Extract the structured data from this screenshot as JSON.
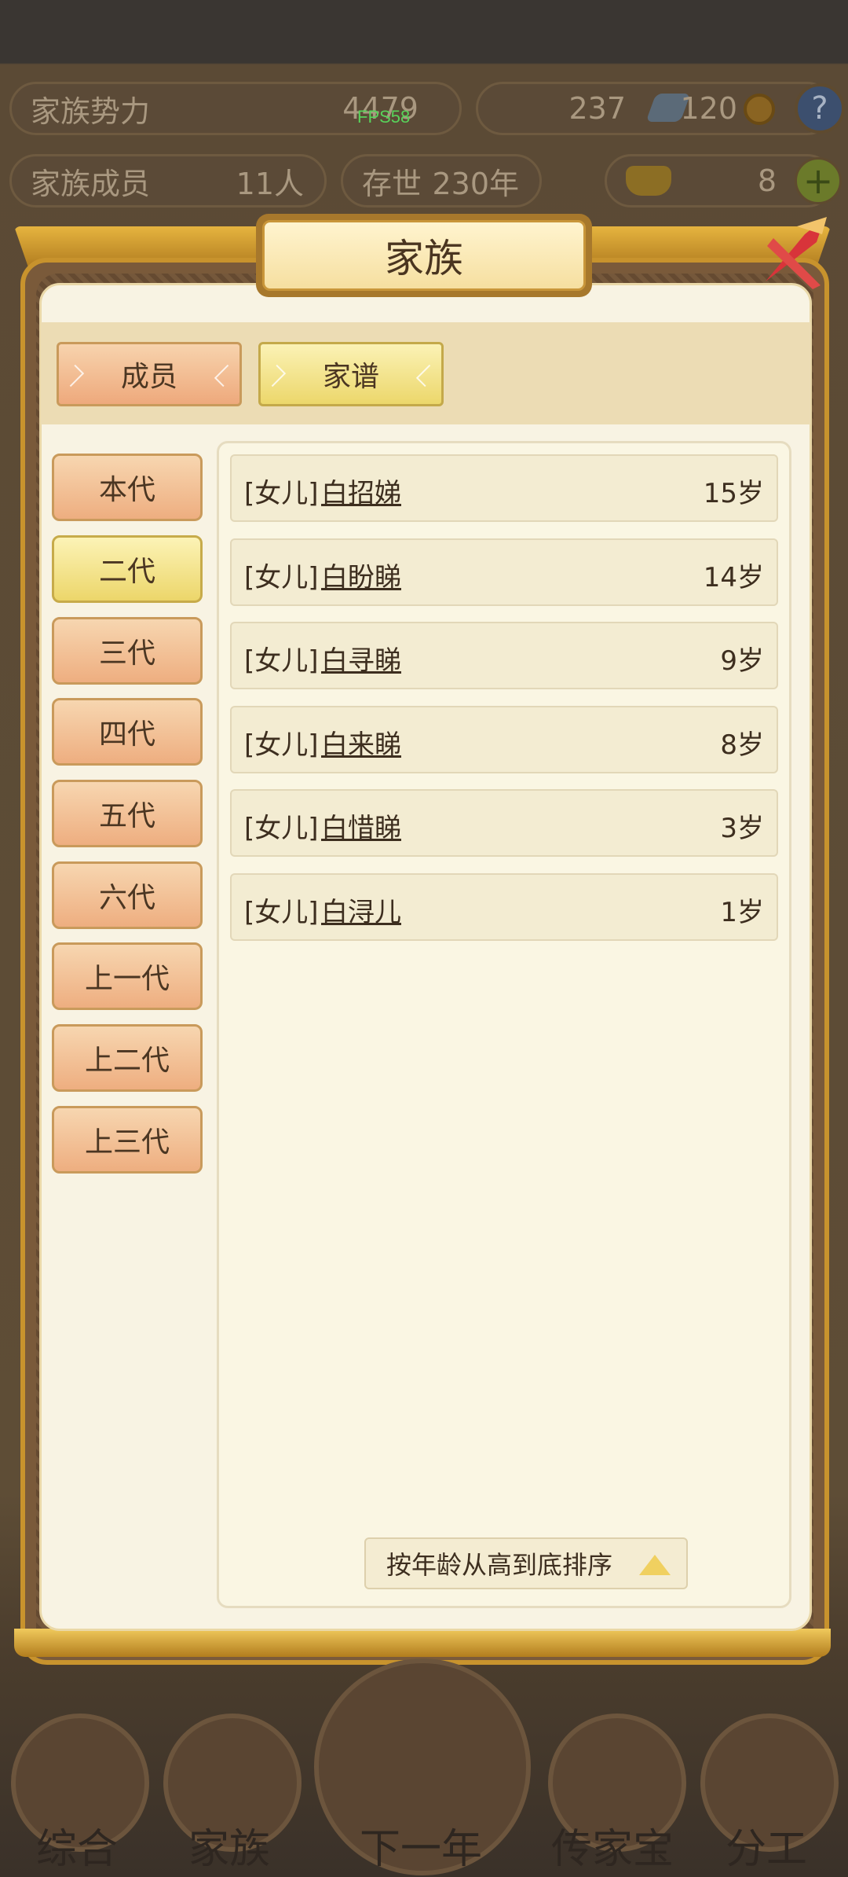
{
  "hud": {
    "family_power_label": "家族势力",
    "family_power_value": "4479",
    "fps": "FPS58",
    "silver": "237",
    "coins": "120",
    "help": "?",
    "members_label": "家族成员",
    "members_value": "11人",
    "alive_label": "存世",
    "alive_value": "230年",
    "gold": "8",
    "plus": "+"
  },
  "modal": {
    "title": "家族",
    "tabs": [
      {
        "label": "成员",
        "active": false
      },
      {
        "label": "家谱",
        "active": true
      }
    ],
    "generations": [
      {
        "label": "本代",
        "active": false
      },
      {
        "label": "二代",
        "active": true
      },
      {
        "label": "三代",
        "active": false
      },
      {
        "label": "四代",
        "active": false
      },
      {
        "label": "五代",
        "active": false
      },
      {
        "label": "六代",
        "active": false
      },
      {
        "label": "上一代",
        "active": false
      },
      {
        "label": "上二代",
        "active": false
      },
      {
        "label": "上三代",
        "active": false
      }
    ],
    "members": [
      {
        "relation": "[女儿]",
        "name": "白招娣",
        "age": "15岁"
      },
      {
        "relation": "[女儿]",
        "name": "白盼睇",
        "age": "14岁"
      },
      {
        "relation": "[女儿]",
        "name": "白寻睇",
        "age": "9岁"
      },
      {
        "relation": "[女儿]",
        "name": "白来睇",
        "age": "8岁"
      },
      {
        "relation": "[女儿]",
        "name": "白惜睇",
        "age": "3岁"
      },
      {
        "relation": "[女儿]",
        "name": "白浔儿",
        "age": "1岁"
      }
    ],
    "sort_label": "按年龄从高到底排序"
  },
  "bottom_nav": [
    {
      "label": "综合",
      "icon": "scroll-icon"
    },
    {
      "label": "家族",
      "icon": "house-icon"
    },
    {
      "label": "下一年",
      "icon": "mountain-icon"
    },
    {
      "label": "传家宝",
      "icon": "jade-icon"
    },
    {
      "label": "分工",
      "icon": "people-icon"
    }
  ],
  "colors": {
    "tab_active": "#ecd76b",
    "tab_inactive": "#eea97c",
    "frame_gold": "#c8932d",
    "panel_bg": "#f8f3e3"
  }
}
